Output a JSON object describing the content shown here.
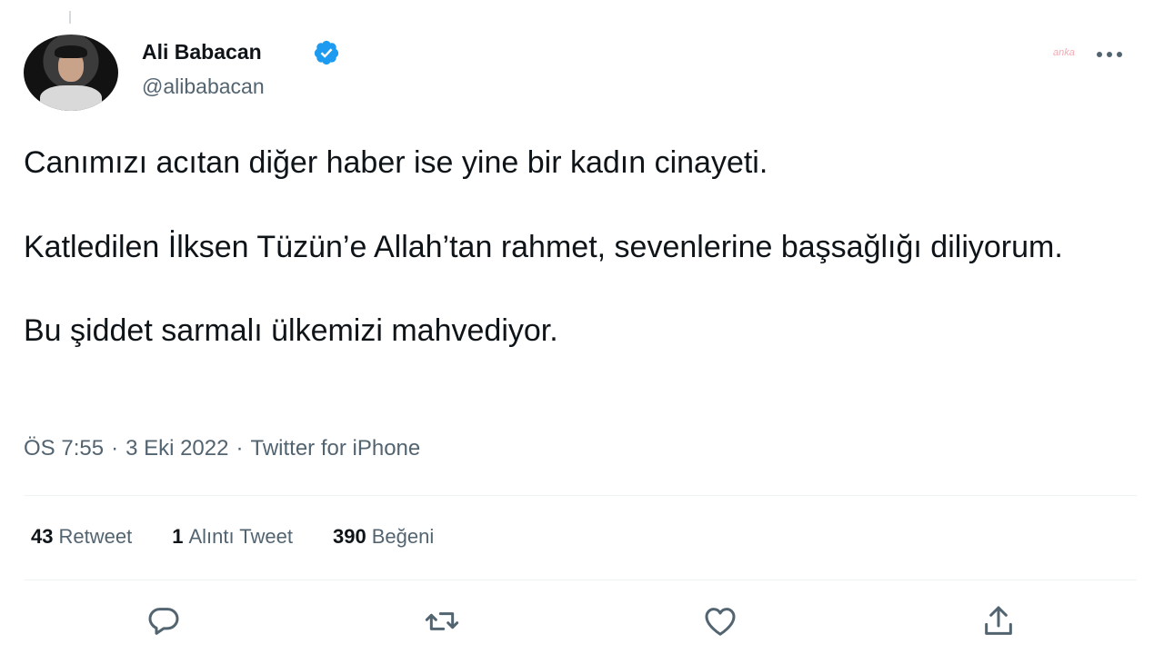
{
  "tweet": {
    "author_name": "Ali Babacan",
    "handle": "@alibabacan",
    "watermark": "anka",
    "paragraphs": [
      "Canımızı acıtan diğer haber ise yine bir kadın cinayeti.",
      "Katledilen İlksen Tüzün’e Allah’tan rahmet, sevenlerine başsağlığı diliyorum.",
      "Bu şiddet sarmalı ülkemizi mahvediyor."
    ],
    "time": "ÖS 7:55",
    "date": "3 Eki 2022",
    "separator": "·",
    "source": "Twitter for iPhone"
  },
  "stats": {
    "retweets_count": "43",
    "retweets_label": "Retweet",
    "quotes_count": "1",
    "quotes_label": "Alıntı Tweet",
    "likes_count": "390",
    "likes_label": "Beğeni"
  },
  "icons": {
    "verified": "verified-badge-icon",
    "reply": "reply-icon",
    "retweet": "retweet-icon",
    "like": "heart-icon",
    "share": "share-icon",
    "more": "more-icon"
  },
  "colors": {
    "verified_blue": "#1d9bf0",
    "muted_text": "#536471",
    "primary_text": "#0f1419"
  }
}
